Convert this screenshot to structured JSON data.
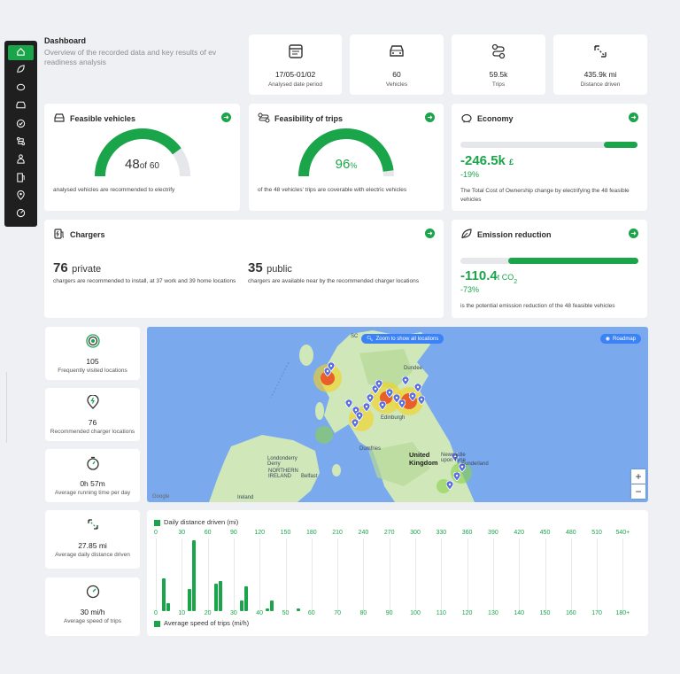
{
  "sidebar": {
    "items": [
      {
        "icon": "home-icon",
        "active": true
      },
      {
        "icon": "leaf-icon"
      },
      {
        "icon": "piggy-bank-icon"
      },
      {
        "icon": "car-icon"
      },
      {
        "icon": "check-circle-icon"
      },
      {
        "icon": "route-icon"
      },
      {
        "icon": "person-icon"
      },
      {
        "icon": "charging-station-icon"
      },
      {
        "icon": "location-pin-icon"
      },
      {
        "icon": "speed-icon"
      }
    ]
  },
  "header": {
    "title": "Dashboard",
    "subtitle": "Overview of the recorded data and key results of ev readiness analysis"
  },
  "stats_top": [
    {
      "value": "17/05-01/02",
      "label": "Analysed date period",
      "icon": "calendar-icon"
    },
    {
      "value": "60",
      "label": "Vehicles",
      "icon": "car-icon"
    },
    {
      "value": "59.5k",
      "label": "Trips",
      "icon": "route-icon"
    },
    {
      "value": "435.9k mi",
      "label": "Distance driven",
      "icon": "distance-icon"
    }
  ],
  "feasible_vehicles": {
    "title": "Feasible vehicles",
    "value": "48",
    "of": "of 60",
    "fraction": 0.8,
    "caption": "analysed vehicles are recommended to electrify"
  },
  "feasible_trips": {
    "title": "Feasibility of trips",
    "value": "96",
    "unit": "%",
    "fraction": 0.96,
    "caption": "of the 48 vehicles' trips are coverable with electric vehicles"
  },
  "economy": {
    "title": "Economy",
    "value": "-246.5k",
    "unit": "£",
    "pct": "-19%",
    "fraction": 0.19,
    "caption": "The Total Cost of Ownership change by electrifying the 48 feasible vehicles"
  },
  "chargers": {
    "title": "Chargers",
    "private_value": "76",
    "private_label": "private",
    "private_caption": "chargers are recommended to install, at 37 work and 39 home locations",
    "public_value": "35",
    "public_label": "public",
    "public_caption": "chargers are available near by the recommended charger locations"
  },
  "emission": {
    "title": "Emission reduction",
    "value": "-110.4",
    "unit": "t CO",
    "unit_sub": "2",
    "pct": "-73%",
    "fraction": 0.73,
    "caption": "is the potential emission reduction of the 48 feasible vehicles"
  },
  "stats_side": [
    {
      "value": "105",
      "label": "Frequently visited locations",
      "icon": "target-icon"
    },
    {
      "value": "76",
      "label": "Recommended charger locations",
      "icon": "charging-pin-icon"
    },
    {
      "value": "0h 57m",
      "label": "Average running time per day",
      "icon": "stopwatch-icon"
    },
    {
      "value": "27.85 mi",
      "label": "Average daily distance driven",
      "icon": "distance-icon"
    },
    {
      "value": "30 mi/h",
      "label": "Average speed of trips",
      "icon": "speedometer-icon"
    }
  ],
  "map": {
    "zoom_all_label": "Zoom to show all locations",
    "roadmap_label": "Roadmap",
    "zoom_in": "+",
    "zoom_out": "−",
    "labels": {
      "united_kingdom": "United\nKingdom",
      "northern_ireland": "NORTHERN\nIRELAND",
      "ireland": "Ireland",
      "dundee": "Dundee",
      "edinburgh": "Edinburgh",
      "belfast": "Belfast",
      "londonderry": "Londonderry\nDerry",
      "newcastle": "Newcastle\nupon Tyne",
      "sunderland": "Sunderland",
      "dumfries": "Dumfries",
      "google": "Google",
      "sc": "SC"
    }
  },
  "chart_data": {
    "type": "bar",
    "legend_top": "Daily distance driven (mi)",
    "legend_bottom": "Average speed of trips (mi/h)",
    "top_ticks": [
      "0",
      "30",
      "60",
      "90",
      "120",
      "150",
      "180",
      "210",
      "240",
      "270",
      "300",
      "330",
      "360",
      "390",
      "420",
      "450",
      "480",
      "510",
      "540+"
    ],
    "bottom_ticks": [
      "0",
      "10",
      "20",
      "30",
      "40",
      "50",
      "60",
      "70",
      "80",
      "90",
      "100",
      "110",
      "120",
      "130",
      "140",
      "150",
      "160",
      "170",
      "180+"
    ],
    "series": [
      {
        "name": "Daily distance driven (mi)",
        "values": [
          12,
          8,
          10,
          4,
          1,
          0,
          0,
          0,
          0,
          0,
          0,
          0,
          0,
          0,
          0,
          0,
          0,
          0,
          0
        ]
      },
      {
        "name": "Average speed of trips (mi/h)",
        "values": [
          3,
          26,
          11,
          9,
          4,
          1,
          0,
          0,
          0,
          0,
          0,
          0,
          0,
          0,
          0,
          0,
          0,
          0,
          0
        ]
      }
    ]
  },
  "colors": {
    "accent": "#1aa54a",
    "sidebar": "#1f1f1f",
    "map_water": "#7aa9ee",
    "map_land": "#cfe7b9",
    "pin": "#5b6ee1"
  }
}
